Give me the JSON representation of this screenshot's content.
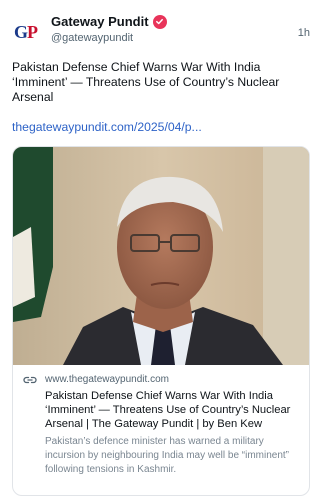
{
  "author": {
    "avatar_letters": [
      "G",
      "P"
    ],
    "display_name": "Gateway Pundit",
    "handle": "@gatewaypundit",
    "timestamp": "1h"
  },
  "post": {
    "text": "Pakistan Defense Chief Warns War With India ‘Imminent’ — Threatens Use of Country’s Nuclear Arsenal",
    "link_text": "thegatewaypundit.com/2025/04/p..."
  },
  "card": {
    "domain": "www.thegatewaypundit.com",
    "title": "Pakistan Defense Chief Warns War With India ‘Imminent’ — Threatens Use of Country’s Nuclear Arsenal | The Gateway Pundit | by Ben Kew",
    "description": "Pakistan’s defence minister has warned a military incursion by neighbouring India may well be “imminent” following tensions in Kashmir."
  },
  "colors": {
    "verified_badge": "#e8345a",
    "link": "#2e63c7",
    "avatar_primary": "#1b3a8a",
    "avatar_accent": "#c8102e"
  },
  "icons": {
    "verified": "verified-badge-icon",
    "link": "link-icon"
  }
}
